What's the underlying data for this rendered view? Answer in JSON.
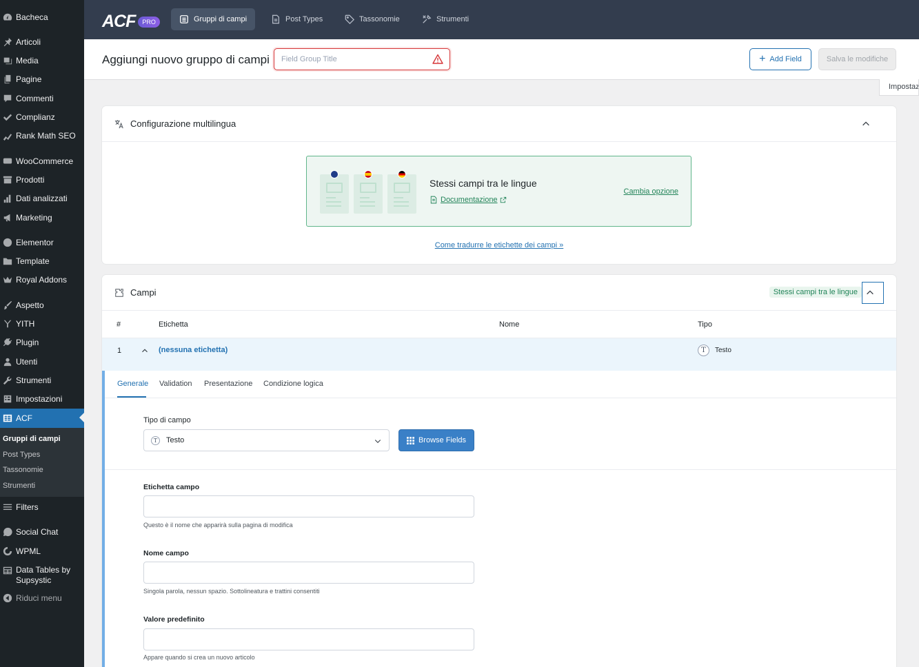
{
  "sidebar": {
    "items": [
      {
        "label": "Bacheca",
        "icon": "dashboard-icon"
      },
      {
        "label": "Articoli",
        "icon": "pin-icon"
      },
      {
        "label": "Media",
        "icon": "media-icon"
      },
      {
        "label": "Pagine",
        "icon": "pages-icon"
      },
      {
        "label": "Commenti",
        "icon": "comment-icon"
      },
      {
        "label": "Complianz",
        "icon": "check-icon"
      },
      {
        "label": "Rank Math SEO",
        "icon": "chart-icon"
      },
      {
        "label": "WooCommerce",
        "icon": "woo-icon"
      },
      {
        "label": "Prodotti",
        "icon": "archive-icon"
      },
      {
        "label": "Dati analizzati",
        "icon": "bar-chart-icon"
      },
      {
        "label": "Marketing",
        "icon": "megaphone-icon"
      },
      {
        "label": "Elementor",
        "icon": "elementor-icon"
      },
      {
        "label": "Template",
        "icon": "folder-icon"
      },
      {
        "label": "Royal Addons",
        "icon": "crown-icon"
      },
      {
        "label": "Aspetto",
        "icon": "brush-icon"
      },
      {
        "label": "YITH",
        "icon": "yith-icon"
      },
      {
        "label": "Plugin",
        "icon": "plug-icon"
      },
      {
        "label": "Utenti",
        "icon": "user-icon"
      },
      {
        "label": "Strumenti",
        "icon": "wrench-icon"
      },
      {
        "label": "Impostazioni",
        "icon": "settings-icon"
      },
      {
        "label": "ACF",
        "icon": "table-icon"
      },
      {
        "label": "Filters",
        "icon": "filter-icon"
      },
      {
        "label": "Social Chat",
        "icon": "whatsapp-icon"
      },
      {
        "label": "WPML",
        "icon": "wpml-icon"
      },
      {
        "label": "Data Tables by Supsystic",
        "icon": "grid-icon"
      },
      {
        "label": "Riduci menu",
        "icon": "collapse-icon"
      }
    ],
    "submenu": [
      "Gruppi di campi",
      "Post Types",
      "Tassonomie",
      "Strumenti"
    ]
  },
  "topbar": {
    "logo": "ACF",
    "badge": "PRO",
    "tabs": [
      "Gruppi di campi",
      "Post Types",
      "Tassonomie",
      "Strumenti"
    ]
  },
  "header": {
    "title": "Aggiungi nuovo gruppo di campi",
    "title_placeholder": "Field Group Title",
    "add_field": "Add Field",
    "save": "Salva le modifiche",
    "settings_tab": "Impostazioni"
  },
  "multilingual": {
    "heading": "Configurazione multilingua",
    "box_title": "Stessi campi tra le lingue",
    "doc_link": "Documentazione",
    "change_option": "Cambia opzione",
    "help_link": "Come tradurre le etichette dei campi »"
  },
  "fields": {
    "heading": "Campi",
    "badge": "Stessi campi tra le lingue",
    "columns": [
      "#",
      "Etichetta",
      "Nome",
      "Tipo"
    ],
    "row": {
      "num": "1",
      "label": "(nessuna etichetta)",
      "type": "Testo"
    },
    "tabs": [
      "Generale",
      "Validation",
      "Presentazione",
      "Condizione logica"
    ],
    "field_type_label": "Tipo di campo",
    "field_type_value": "Testo",
    "browse": "Browse Fields",
    "label_label": "Etichetta campo",
    "label_help": "Questo è il nome che apparirà sulla pagina di modifica",
    "name_label": "Nome campo",
    "name_help": "Singola parola, nessun spazio. Sottolineatura e trattini consentiti",
    "default_label": "Valore predefinito",
    "default_help": "Appare quando si crea un nuovo articolo"
  },
  "colors": {
    "sidebar_bg": "#1d2327",
    "topbar_bg": "#333d4e",
    "accent": "#2271b1",
    "success": "#218358",
    "error": "#d63638"
  }
}
